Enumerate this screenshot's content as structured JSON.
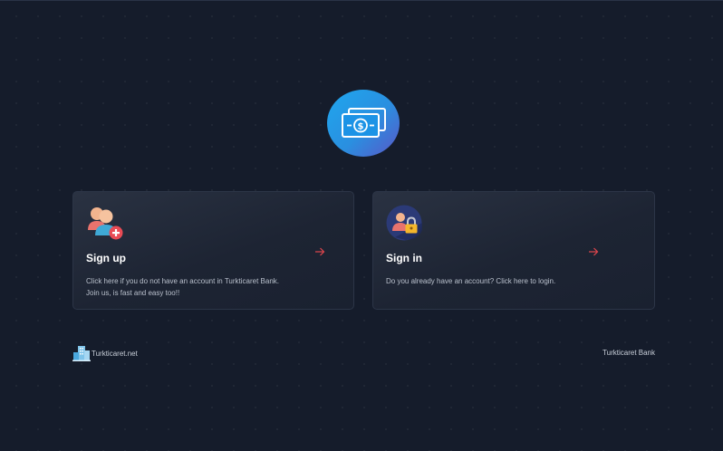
{
  "logo": {
    "icon": "money-bills-icon",
    "accent": "#2a8fe0"
  },
  "signup": {
    "icon": "users-add-icon",
    "title": "Sign up",
    "desc_line1": "Click here if you do not have an account in Turkticaret Bank.",
    "desc_line2": "Join us, is fast and easy too!!",
    "arrow": "arrow-right-icon"
  },
  "signin": {
    "icon": "user-lock-icon",
    "title": "Sign in",
    "desc_line1": "Do you already have an account? Click here to login.",
    "arrow": "arrow-right-icon"
  },
  "footer": {
    "left_icon": "buildings-icon",
    "left_text": "Turkticaret.net",
    "right_text": "Turkticaret Bank"
  },
  "colors": {
    "background": "#151c2b",
    "card_border": "#2c3547",
    "arrow": "#e0464d",
    "text_muted": "#b9c0cc"
  }
}
